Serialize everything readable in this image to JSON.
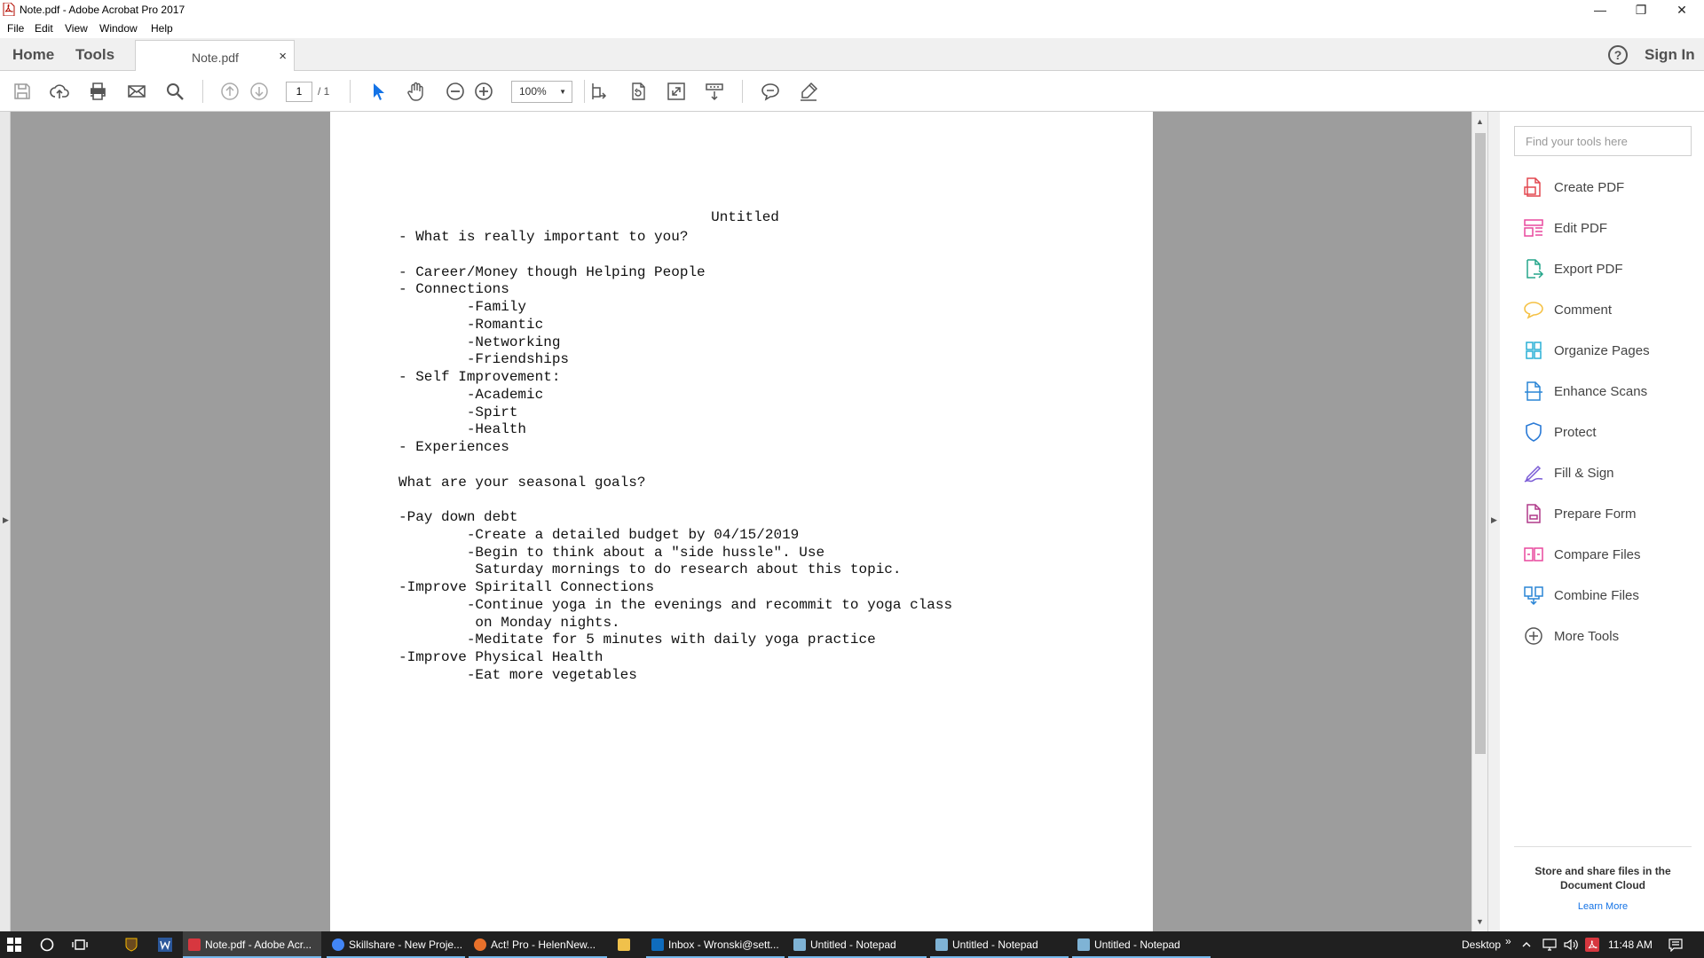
{
  "window": {
    "title": "Note.pdf - Adobe Acrobat Pro 2017",
    "minimize": "—",
    "restore": "❐",
    "close": "✕"
  },
  "menu": [
    "File",
    "Edit",
    "View",
    "Window",
    "Help"
  ],
  "tabs": {
    "home": "Home",
    "tools": "Tools",
    "doc": "Note.pdf",
    "doc_close": "×",
    "help": "?",
    "signin": "Sign In"
  },
  "toolbar": {
    "page_current": "1",
    "page_total": "/ 1",
    "zoom": "100%",
    "zoom_arrow": "▼"
  },
  "document": {
    "title": "Untitled",
    "lines": [
      "- What is really important to you?",
      "",
      "- Career/Money though Helping People",
      "- Connections",
      "        -Family",
      "        -Romantic",
      "        -Networking",
      "        -Friendships",
      "- Self Improvement:",
      "        -Academic",
      "        -Spirt",
      "        -Health",
      "- Experiences",
      "",
      "What are your seasonal goals?",
      "",
      "-Pay down debt",
      "        -Create a detailed budget by 04/15/2019",
      "        -Begin to think about a \"side hussle\". Use",
      "         Saturday mornings to do research about this topic.",
      "-Improve Spiritall Connections",
      "        -Continue yoga in the evenings and recommit to yoga class",
      "         on Monday nights.",
      "        -Meditate for 5 minutes with daily yoga practice",
      "-Improve Physical Health",
      "        -Eat more vegetables"
    ]
  },
  "scroll": {
    "up": "▲",
    "down": "▼",
    "left": "◀",
    "right": "▶"
  },
  "panel": {
    "search_placeholder": "Find your tools here",
    "tools": [
      {
        "label": "Create PDF",
        "icon": "create-pdf-icon",
        "color": "#e34850"
      },
      {
        "label": "Edit PDF",
        "icon": "edit-pdf-icon",
        "color": "#e8489d"
      },
      {
        "label": "Export PDF",
        "icon": "export-pdf-icon",
        "color": "#26a68b"
      },
      {
        "label": "Comment",
        "icon": "comment-icon",
        "color": "#f5c144"
      },
      {
        "label": "Organize Pages",
        "icon": "organize-pages-icon",
        "color": "#2ab0d6"
      },
      {
        "label": "Enhance Scans",
        "icon": "enhance-scans-icon",
        "color": "#2a85d6"
      },
      {
        "label": "Protect",
        "icon": "protect-icon",
        "color": "#2a7ad6"
      },
      {
        "label": "Fill & Sign",
        "icon": "fill-sign-icon",
        "color": "#7a5bd6"
      },
      {
        "label": "Prepare Form",
        "icon": "prepare-form-icon",
        "color": "#b03a8a"
      },
      {
        "label": "Compare Files",
        "icon": "compare-files-icon",
        "color": "#e8489d"
      },
      {
        "label": "Combine Files",
        "icon": "combine-files-icon",
        "color": "#2a85d6"
      },
      {
        "label": "More Tools",
        "icon": "more-tools-icon",
        "color": "#555555"
      }
    ],
    "cloud_text": "Store and share files in the Document Cloud",
    "learn_more": "Learn More"
  },
  "taskbar": {
    "tasks": [
      {
        "label": "Note.pdf - Adobe Acr...",
        "color": "#d7373f",
        "active": true
      },
      {
        "label": "Skillshare - New Proje...",
        "color": "#4285f4",
        "active": false
      },
      {
        "label": "Act! Pro - HelenNew...",
        "color": "#e8712b",
        "active": false
      },
      {
        "label": "",
        "color": "#f0c14b",
        "active": false
      },
      {
        "label": "Inbox - Wronski@sett...",
        "color": "#0f6cbd",
        "active": false
      },
      {
        "label": "Untitled - Notepad",
        "color": "#7fb3d5",
        "active": false
      },
      {
        "label": "Untitled - Notepad",
        "color": "#7fb3d5",
        "active": false
      },
      {
        "label": "Untitled - Notepad",
        "color": "#7fb3d5",
        "active": false
      }
    ],
    "desktop": "Desktop",
    "chevron": "»",
    "time": "11:48 AM"
  }
}
